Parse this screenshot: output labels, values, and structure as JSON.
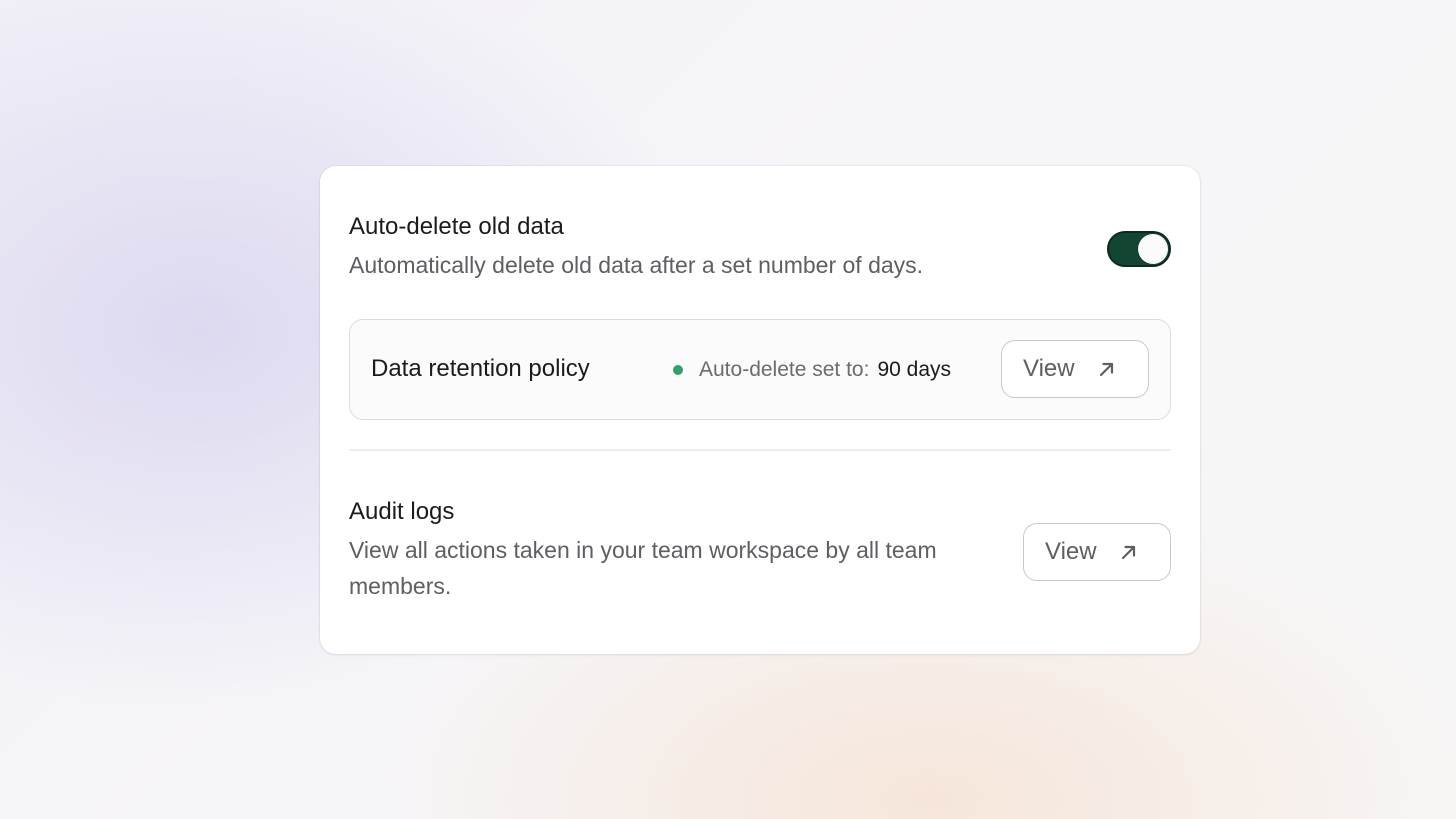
{
  "auto_delete": {
    "title": "Auto-delete old data",
    "description": "Automatically delete old data after a set number of days.",
    "toggle_on": true
  },
  "retention_policy": {
    "title": "Data retention policy",
    "status_label": "Auto-delete set to:",
    "status_value": "90 days",
    "status_color": "#2fa36b",
    "button_label": "View",
    "button_icon": "arrow-up-right-icon"
  },
  "audit_logs": {
    "title": "Audit logs",
    "description": "View all actions taken in your team workspace by all team members.",
    "button_label": "View",
    "button_icon": "arrow-up-right-icon"
  },
  "colors": {
    "toggle_track": "#124532",
    "status_dot": "#2fa36b"
  }
}
